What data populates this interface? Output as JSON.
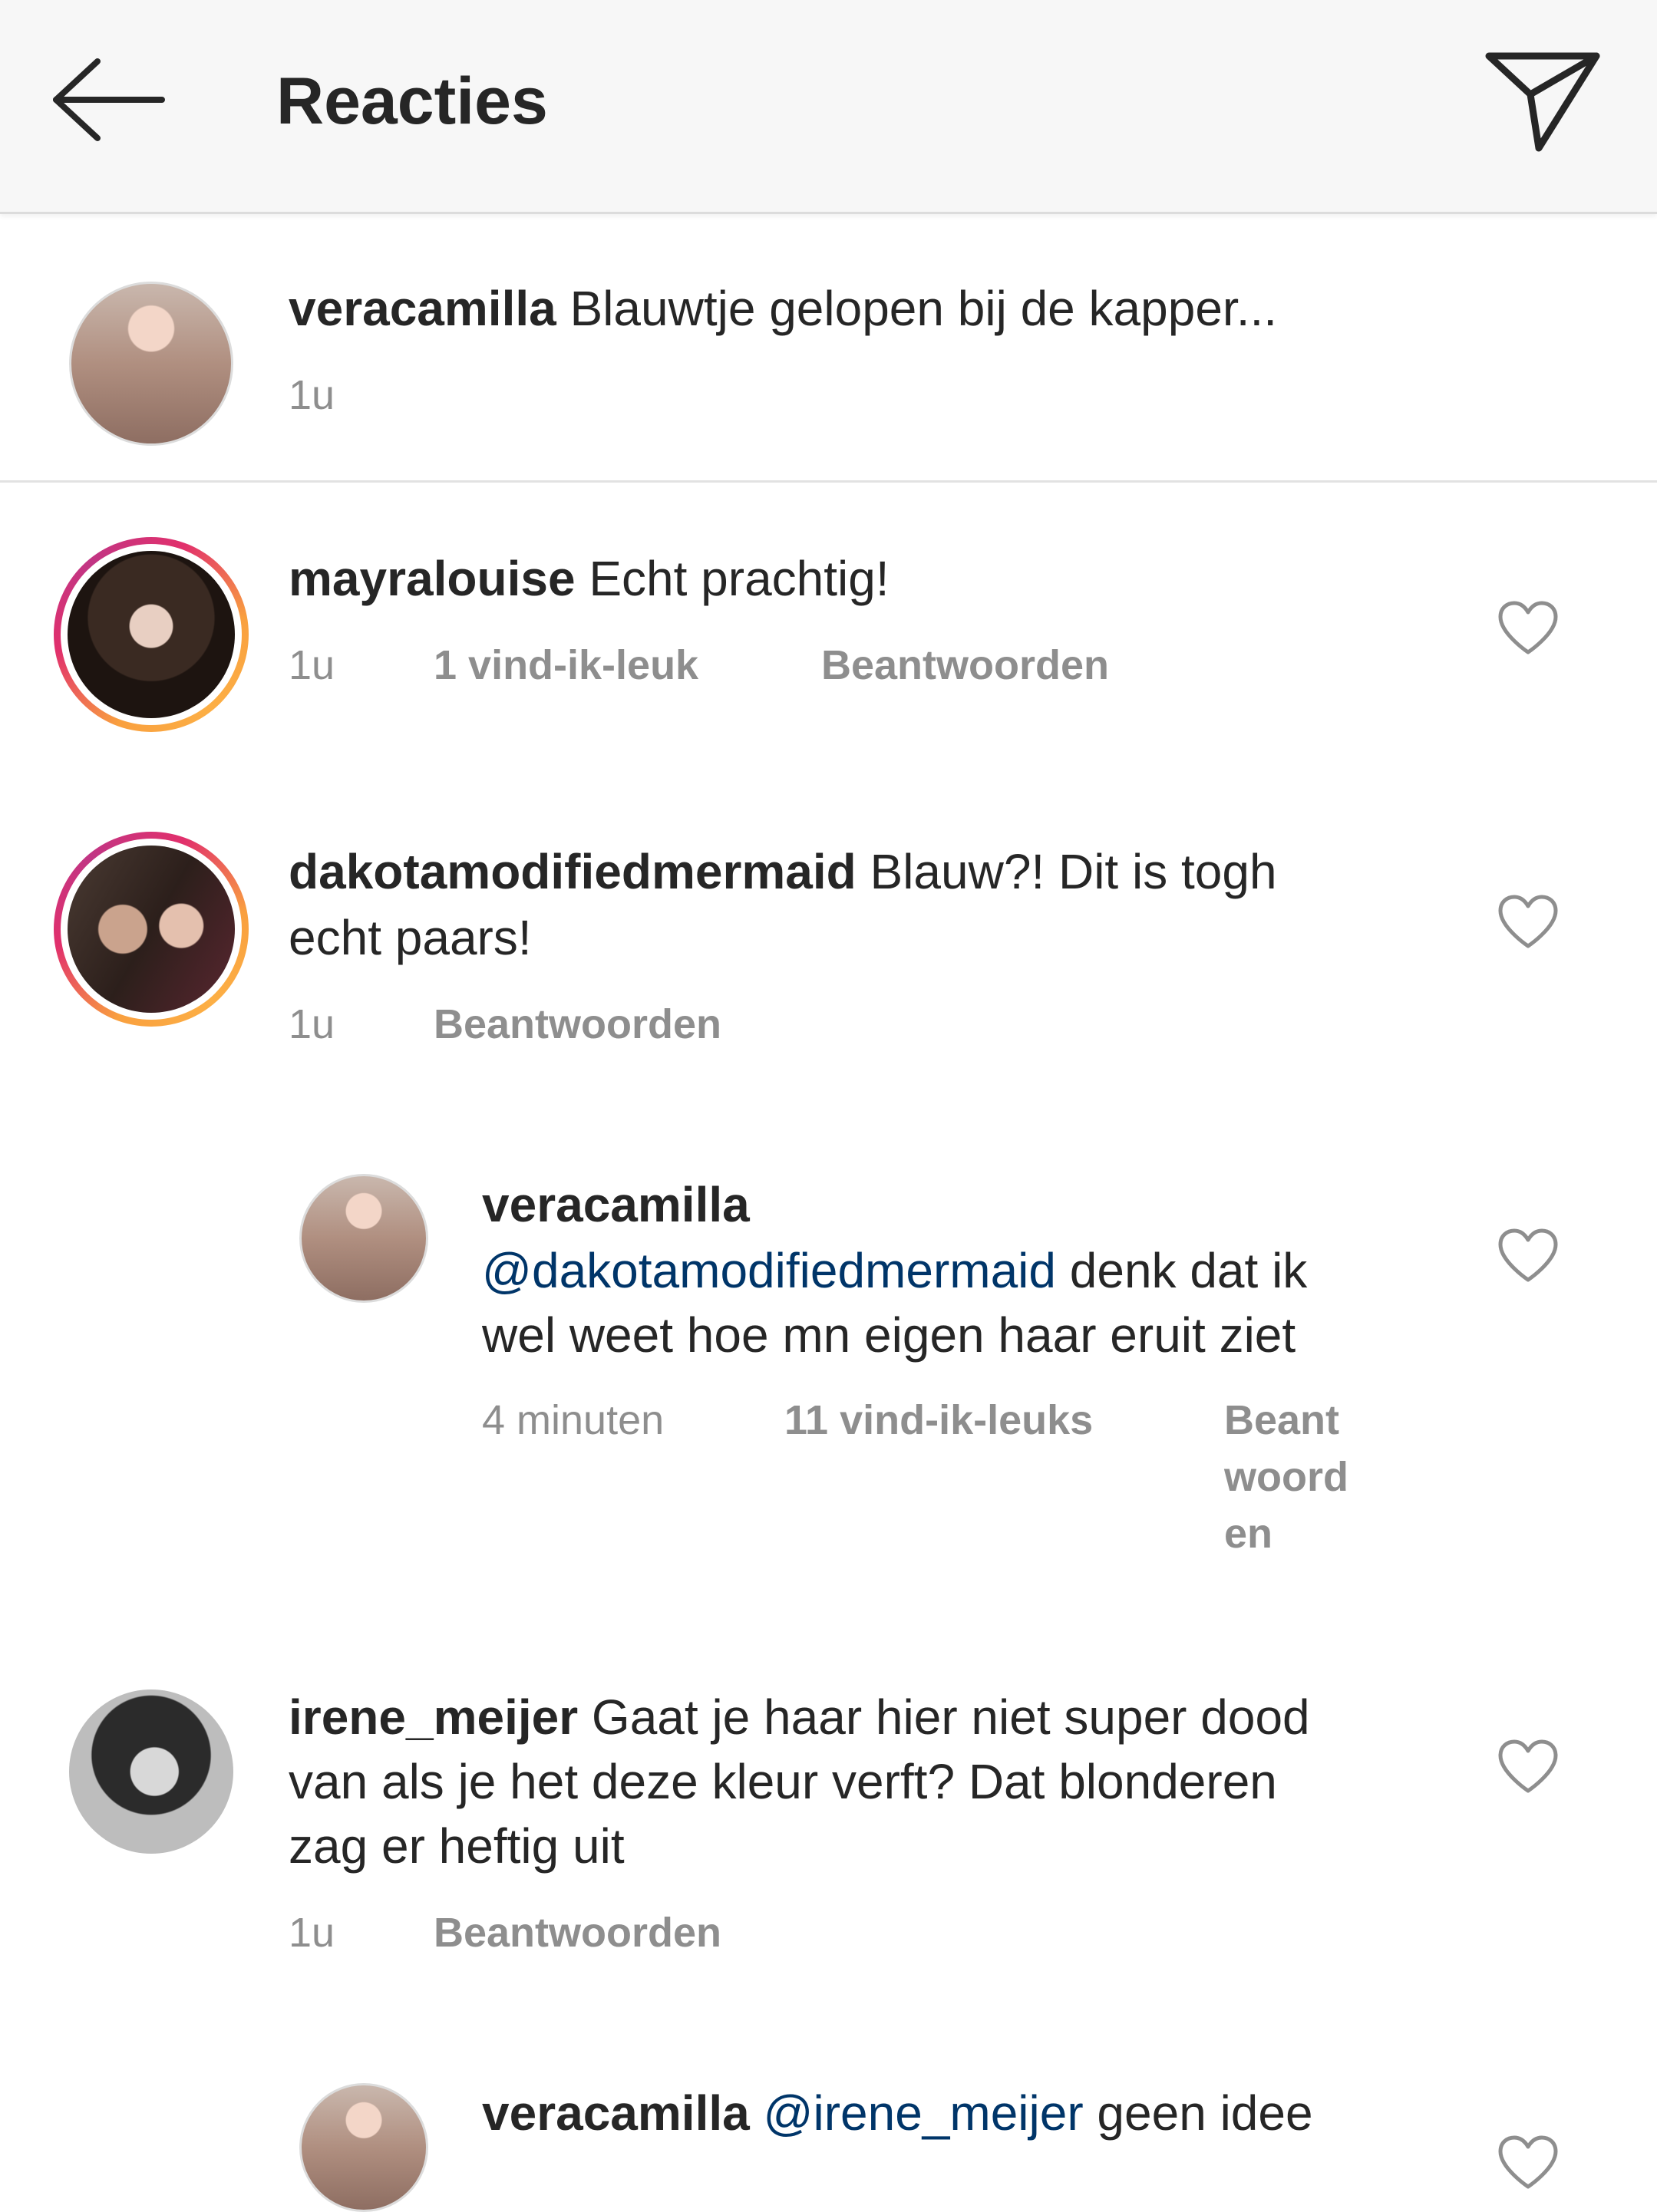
{
  "header": {
    "title": "Reacties",
    "back_icon": "arrow-left-icon",
    "send_icon": "paper-plane-icon"
  },
  "caption": {
    "username": "veracamilla",
    "text": "Blauwtje gelopen bij de kapper...",
    "time": "1u"
  },
  "comments": [
    {
      "username": "mayralouise",
      "text": "Echt prachtig!",
      "time": "1u",
      "likes": "1 vind-ik-leuk",
      "reply_label": "Beantwoorden"
    },
    {
      "username": "dakotamodifiedmermaid",
      "text_line1": "Blauw?! Dit is togh",
      "text_line2": "echt paars!",
      "time": "1u",
      "reply_label": "Beantwoorden"
    },
    {
      "username": "veracamilla",
      "mention": "@dakotamodifiedmermaid",
      "text_line1": "denk dat ik",
      "text_line2": "wel weet hoe mn eigen haar eruit ziet",
      "time": "4 minuten",
      "likes": "11 vind-ik-leuks",
      "reply_line1": "Beant",
      "reply_line2": "woord",
      "reply_line3": "en"
    },
    {
      "username": "irene_meijer",
      "text_line1": "Gaat je haar hier niet super dood",
      "text_line2": "van als je het deze kleur verft? Dat blonderen",
      "text_line3": "zag er heftig uit",
      "time": "1u",
      "reply_label": "Beantwoorden"
    },
    {
      "username": "veracamilla",
      "mention": "@irene_meijer",
      "text": "geen idee"
    }
  ],
  "colors": {
    "header_bg": "#f7f7f7",
    "text": "#262626",
    "meta": "#8e8e8e",
    "mention": "#003569",
    "story_ring_start": "#f9a03f",
    "story_ring_end": "#c13584"
  }
}
